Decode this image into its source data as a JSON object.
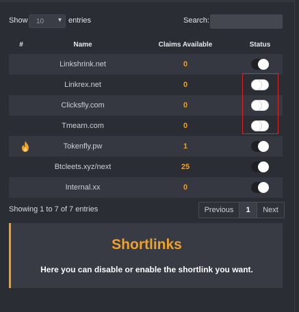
{
  "controls": {
    "show_label": "Show",
    "page_length": "10",
    "entries_label": "entries",
    "search_label": "Search:",
    "search_value": ""
  },
  "table": {
    "headers": {
      "num": "#",
      "name": "Name",
      "claims": "Claims Available",
      "status": "Status"
    },
    "rows": [
      {
        "icon": "",
        "name": "Linkshrink.net",
        "claims": "0",
        "status": "on"
      },
      {
        "icon": "",
        "name": "Linkrex.net",
        "claims": "0",
        "status": "off"
      },
      {
        "icon": "",
        "name": "Clicksfly.com",
        "claims": "0",
        "status": "off"
      },
      {
        "icon": "",
        "name": "Tmearn.com",
        "claims": "0",
        "status": "off"
      },
      {
        "icon": "fire-icon",
        "name": "Tokenfly.pw",
        "claims": "1",
        "status": "on"
      },
      {
        "icon": "",
        "name": "Btcleets.xyz/next",
        "claims": "25",
        "status": "on"
      },
      {
        "icon": "",
        "name": "Internal.xx",
        "claims": "0",
        "status": "on"
      }
    ]
  },
  "pagination": {
    "info": "Showing 1 to 7 of 7 entries",
    "previous": "Previous",
    "current": "1",
    "next": "Next"
  },
  "card": {
    "title": "Shortlinks",
    "text": "Here you can disable or enable the shortlink you want."
  },
  "colors": {
    "accent": "#f0a224",
    "background": "#2b2d35",
    "row_stripe": "#353741",
    "highlight": "#e02525"
  }
}
